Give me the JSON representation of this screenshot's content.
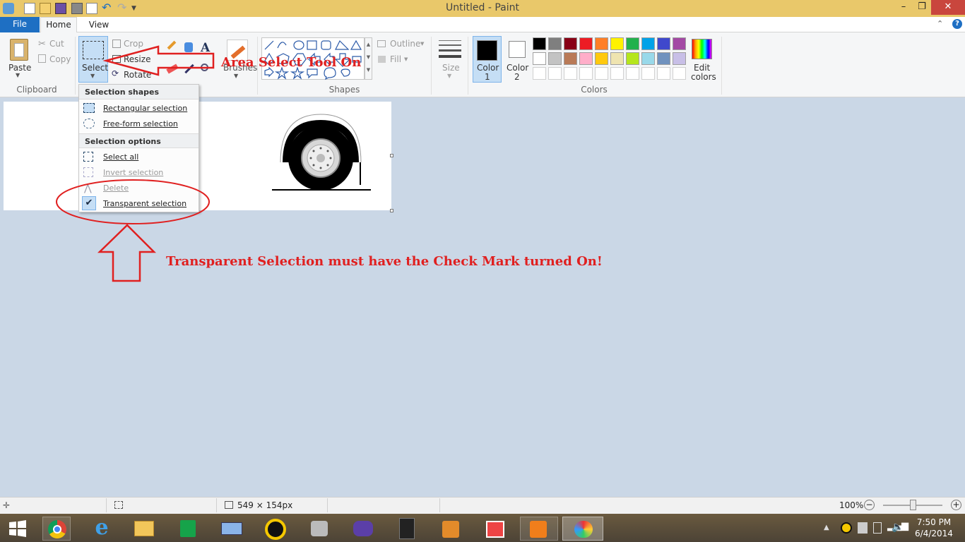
{
  "window": {
    "title": "Untitled - Paint",
    "minimize": "–",
    "maximize": "❐",
    "close": "✕"
  },
  "tabs": {
    "file": "File",
    "home": "Home",
    "view": "View"
  },
  "ribbon": {
    "clipboard": {
      "paste": "Paste",
      "cut": "Cut",
      "copy": "Copy",
      "group": "Clipboard"
    },
    "image": {
      "select": "Select",
      "crop": "Crop",
      "resize": "Resize",
      "rotate": "Rotate"
    },
    "brushes": "Brushes",
    "shapes": {
      "outline": "Outline",
      "fill": "Fill",
      "group": "Shapes"
    },
    "size": "Size",
    "color1": {
      "line1": "Color",
      "line2": "1"
    },
    "color2": {
      "line1": "Color",
      "line2": "2"
    },
    "edit_colors": {
      "line1": "Edit",
      "line2": "colors"
    },
    "colors_group": "Colors",
    "palette": [
      "#000000",
      "#7f7f7f",
      "#880015",
      "#ed1c24",
      "#ff7f27",
      "#fff200",
      "#22b14c",
      "#00a2e8",
      "#3f48cc",
      "#a349a4",
      "#ffffff",
      "#c3c3c3",
      "#b97a57",
      "#ffaec9",
      "#ffc90e",
      "#efe4b0",
      "#b5e61d",
      "#99d9ea",
      "#7092be",
      "#c8bfe7"
    ]
  },
  "select_menu": {
    "shapes_header": "Selection shapes",
    "rectangular": "Rectangular selection",
    "freeform": "Free-form selection",
    "options_header": "Selection options",
    "select_all": "Select all",
    "invert": "Invert selection",
    "delete": "Delete",
    "transparent": "Transparent selection",
    "transparent_checked": true
  },
  "annotations": {
    "area_select": "Area Select Tool On",
    "transparent_note": "Transparent Selection must have the Check Mark turned On!"
  },
  "status": {
    "dimensions": "549 × 154px",
    "zoom": "100%"
  },
  "taskbar": {
    "time": "7:50 PM",
    "date": "6/4/2014"
  }
}
